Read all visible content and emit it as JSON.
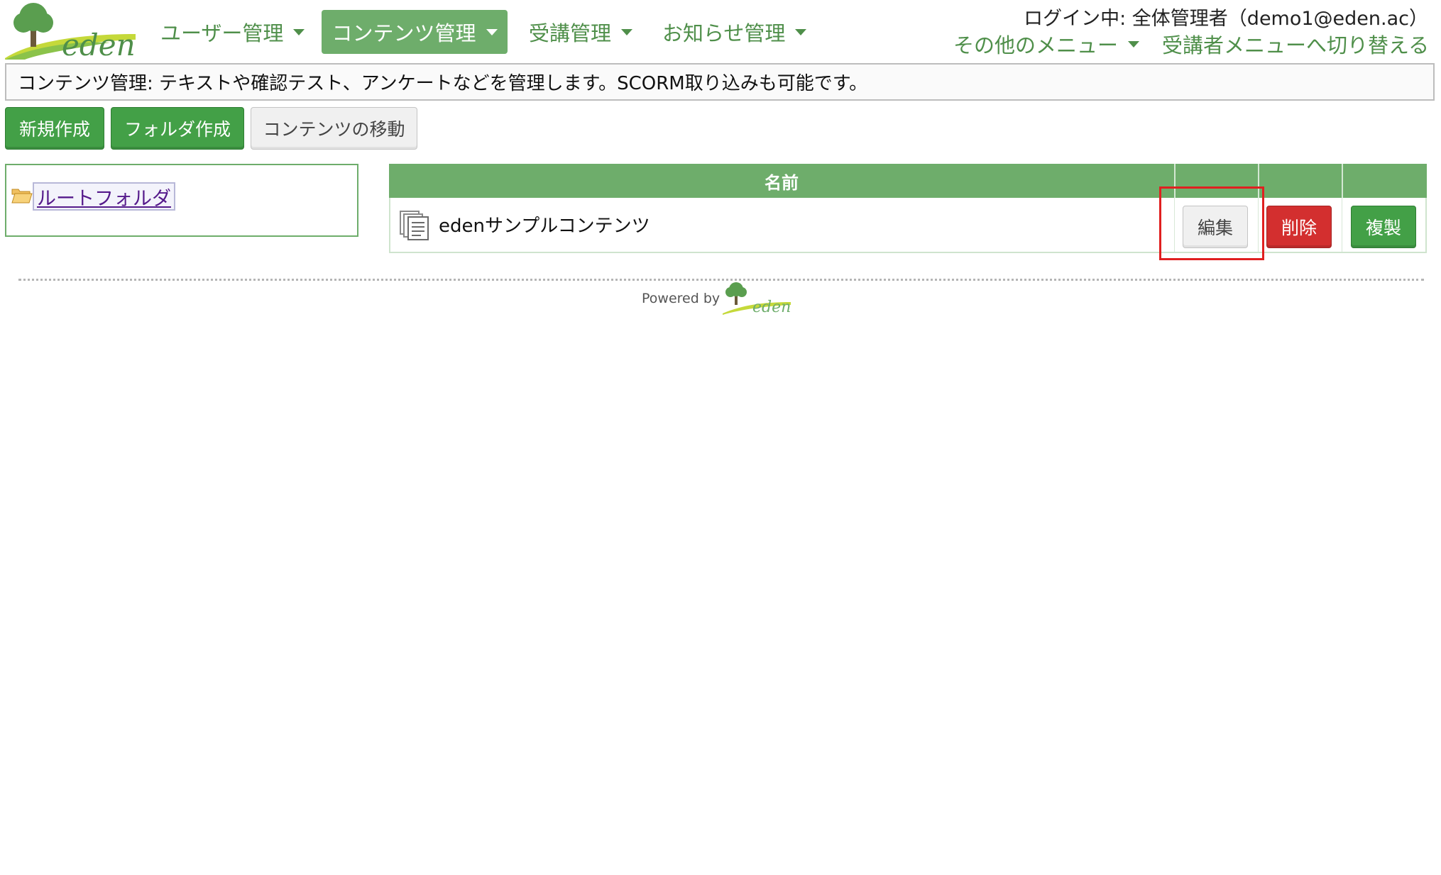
{
  "header": {
    "logo_text": "eden",
    "nav": {
      "user": "ユーザー管理",
      "content": "コンテンツ管理",
      "course": "受講管理",
      "notice": "お知らせ管理"
    },
    "login_text": "ログイン中: 全体管理者（demo1@eden.ac）",
    "other_menu": "その他のメニュー",
    "switch_menu": "受講者メニューへ切り替える"
  },
  "description": "コンテンツ管理: テキストや確認テスト、アンケートなどを管理します。SCORM取り込みも可能です。",
  "actions": {
    "new": "新規作成",
    "folder": "フォルダ作成",
    "move": "コンテンツの移動"
  },
  "tree": {
    "root": "ルートフォルダ"
  },
  "table": {
    "header_name": "名前",
    "rows": [
      {
        "name": "edenサンプルコンテンツ",
        "edit": "編集",
        "delete": "削除",
        "copy": "複製"
      }
    ]
  },
  "footer": {
    "powered_by": "Powered by",
    "logo_text": "eden"
  },
  "colors": {
    "brand_green": "#6ead6b",
    "button_green": "#43a047",
    "danger_red": "#d32f2f",
    "highlight_red": "#e02020"
  },
  "icons": {
    "nav_caret": "caret-down-icon",
    "folder": "open-folder-icon",
    "content": "document-stack-icon",
    "logo": "tree-logo"
  }
}
